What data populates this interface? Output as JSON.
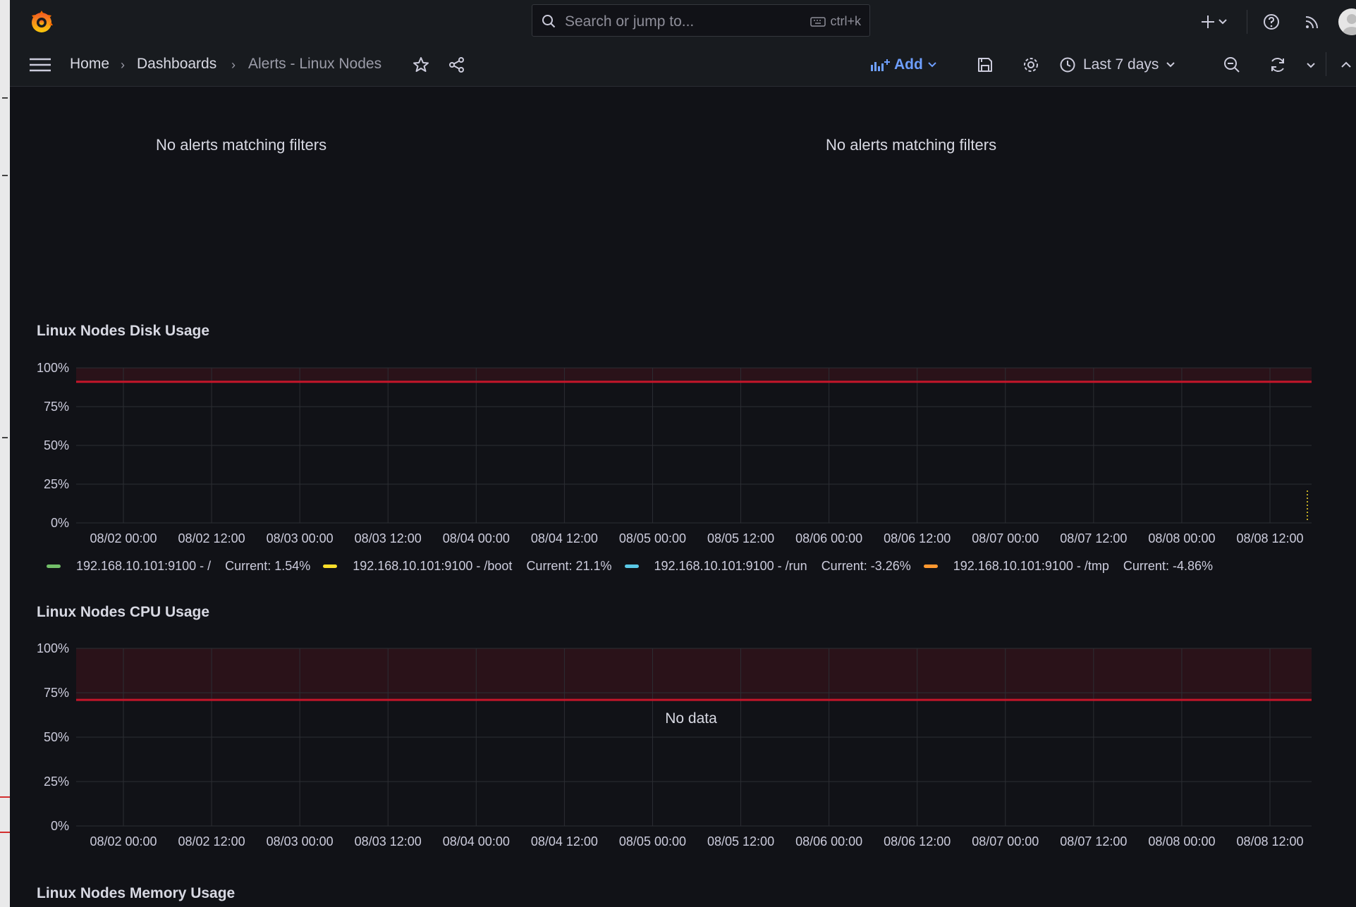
{
  "topbar": {
    "search_placeholder": "Search or jump to...",
    "search_shortcut": "ctrl+k"
  },
  "breadcrumb": {
    "items": [
      "Home",
      "Dashboards",
      "Alerts - Linux Nodes"
    ]
  },
  "toolbar": {
    "add_label": "Add",
    "time_range": "Last 7 days"
  },
  "alert_lists": [
    {
      "message": "No alerts matching filters"
    },
    {
      "message": "No alerts matching filters"
    }
  ],
  "colors": {
    "accent": "#6e9fff",
    "threshold": "#c4162a",
    "background": "#111217"
  },
  "panels": {
    "disk": {
      "title": "Linux Nodes Disk Usage",
      "legend": [
        {
          "name": "192.168.10.101:9100 - /",
          "current": "Current: 1.54%",
          "color": "#73bf69"
        },
        {
          "name": "192.168.10.101:9100 - /boot",
          "current": "Current: 21.1%",
          "color": "#fade2a"
        },
        {
          "name": "192.168.10.101:9100 - /run",
          "current": "Current: -3.26%",
          "color": "#5ac8e6"
        },
        {
          "name": "192.168.10.101:9100 - /tmp",
          "current": "Current: -4.86%",
          "color": "#ff9830"
        }
      ]
    },
    "cpu": {
      "title": "Linux Nodes CPU Usage",
      "no_data": "No data"
    },
    "memory": {
      "title": "Linux Nodes Memory Usage"
    }
  },
  "chart_data": [
    {
      "type": "line",
      "title": "Linux Nodes Disk Usage",
      "yticks": [
        "100%",
        "75%",
        "50%",
        "25%",
        "0%"
      ],
      "ylim": [
        0,
        100
      ],
      "xticks": [
        "08/02 00:00",
        "08/02 12:00",
        "08/03 00:00",
        "08/03 12:00",
        "08/04 00:00",
        "08/04 12:00",
        "08/05 00:00",
        "08/05 12:00",
        "08/06 00:00",
        "08/06 12:00",
        "08/07 00:00",
        "08/07 12:00",
        "08/08 00:00",
        "08/08 12:00"
      ],
      "threshold": 91,
      "series": [
        {
          "name": "192.168.10.101:9100 - /",
          "values": []
        },
        {
          "name": "192.168.10.101:9100 - /boot",
          "values": []
        },
        {
          "name": "192.168.10.101:9100 - /run",
          "values": []
        },
        {
          "name": "192.168.10.101:9100 - /tmp",
          "values": []
        }
      ],
      "legend_position": "bottom",
      "grid": true
    },
    {
      "type": "line",
      "title": "Linux Nodes CPU Usage",
      "yticks": [
        "100%",
        "75%",
        "50%",
        "25%",
        "0%"
      ],
      "ylim": [
        0,
        100
      ],
      "xticks": [
        "08/02 00:00",
        "08/02 12:00",
        "08/03 00:00",
        "08/03 12:00",
        "08/04 00:00",
        "08/04 12:00",
        "08/05 00:00",
        "08/05 12:00",
        "08/06 00:00",
        "08/06 12:00",
        "08/07 00:00",
        "08/07 12:00",
        "08/08 00:00",
        "08/08 12:00"
      ],
      "threshold": 71,
      "series": [],
      "grid": true
    }
  ]
}
